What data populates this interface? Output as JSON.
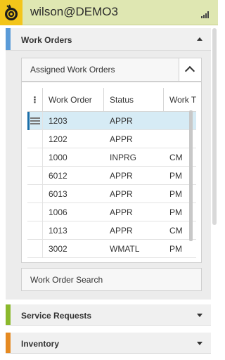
{
  "header": {
    "user_title": "wilson@DEMO3",
    "logo_icon": "maximo-mobile-logo-icon",
    "signal_icon": "signal-strength-icon",
    "bg_color": "#dfe7b2",
    "logo_color": "#f3c51a"
  },
  "sections": {
    "work_orders": {
      "title": "Work Orders",
      "expanded": true,
      "accent": "#5a9bd8"
    },
    "service_requests": {
      "title": "Service Requests",
      "expanded": false,
      "accent": "#8bb92d"
    },
    "inventory": {
      "title": "Inventory",
      "expanded": false,
      "accent": "#e58a22"
    }
  },
  "assigned": {
    "label": "Assigned Work Orders",
    "toggle_icon": "chevron-up-icon"
  },
  "table": {
    "menu_glyph": "⋮",
    "headers": [
      "Work Order",
      "Status",
      "Work T"
    ],
    "rows": [
      {
        "wo": "1203",
        "status": "APPR",
        "type": ""
      },
      {
        "wo": "1202",
        "status": "APPR",
        "type": ""
      },
      {
        "wo": "1000",
        "status": "INPRG",
        "type": "CM"
      },
      {
        "wo": "6012",
        "status": "APPR",
        "type": "PM"
      },
      {
        "wo": "6013",
        "status": "APPR",
        "type": "PM"
      },
      {
        "wo": "1006",
        "status": "APPR",
        "type": "PM"
      },
      {
        "wo": "1013",
        "status": "APPR",
        "type": "CM"
      },
      {
        "wo": "3002",
        "status": "WMATL",
        "type": "PM"
      }
    ],
    "selected_row": 0
  },
  "search": {
    "label": "Work Order Search"
  }
}
